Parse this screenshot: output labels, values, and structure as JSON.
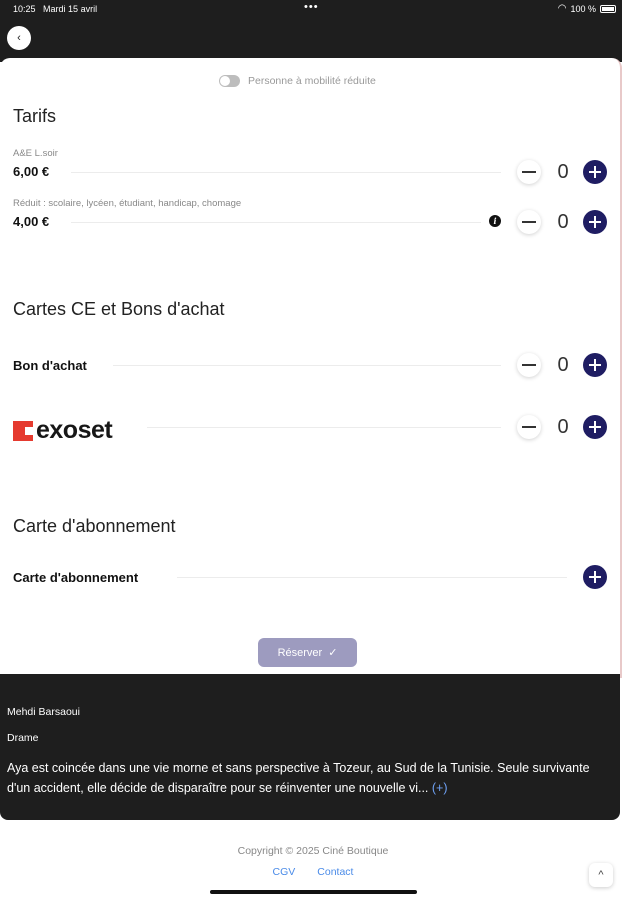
{
  "status_bar": {
    "time": "10:25",
    "date": "Mardi 15 avril",
    "dots": "•••",
    "battery": "100 %"
  },
  "header": {
    "back_icon": "‹"
  },
  "pmr": {
    "label": "Personne à mobilité réduite"
  },
  "tarifs": {
    "title": "Tarifs",
    "items": [
      {
        "name": "A&E L.soir",
        "price": "6,00 €",
        "count": "0"
      },
      {
        "name": "Réduit : scolaire, lycéen, étudiant, handicap, chomage",
        "price": "4,00 €",
        "count": "0"
      }
    ]
  },
  "cartes": {
    "title": "Cartes CE et Bons d'achat",
    "bon_label": "Bon d'achat",
    "bon_count": "0",
    "exoset_label": "exoset",
    "exoset_count": "0"
  },
  "abonnement": {
    "title": "Carte d'abonnement",
    "label": "Carte d'abonnement"
  },
  "reserve": {
    "label": "Réserver",
    "icon": "✓"
  },
  "movie": {
    "director": "Mehdi Barsaoui",
    "genre": "Drame",
    "synopsis": "Aya est coincée dans une vie morne et sans perspective à Tozeur, au Sud de la Tunisie. Seule survivante d'un accident, elle décide de disparaître pour se réinventer une nouvelle vi...",
    "more": "(+)"
  },
  "footer": {
    "copyright": "Copyright © 2025 Ciné Boutique",
    "cgv": "CGV",
    "contact": "Contact",
    "scroll_top_icon": "^"
  },
  "colors": {
    "accent": "#1f1d63",
    "reserve_bg": "#9d9bbf",
    "dark_bg": "#1e1e1e",
    "link": "#4a8be8",
    "exoset_red": "#e53a2f"
  }
}
